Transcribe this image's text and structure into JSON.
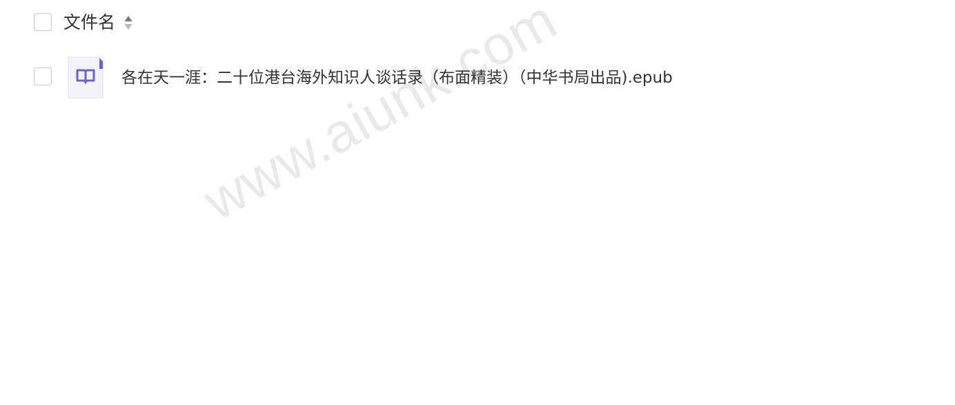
{
  "header": {
    "column_title": "文件名",
    "sort_icon": "sort-updown-icon"
  },
  "files": [
    {
      "name": "各在天一涯：二十位港台海外知识人谈话录（布面精装）（中华书局出品).epub",
      "icon": "book-icon"
    }
  ],
  "watermark": {
    "text": "www.aiunk.com"
  },
  "colors": {
    "text": "#333333",
    "checkbox_border": "#c9c9c9",
    "file_icon_accent": "#6b63c9",
    "file_icon_bg": "#f4f3fb"
  }
}
